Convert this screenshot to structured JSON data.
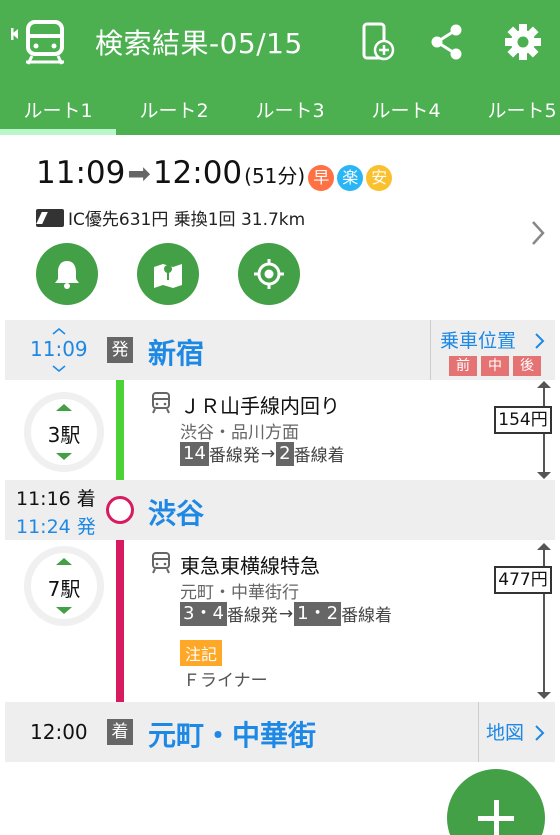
{
  "header": {
    "title": "検索結果-05/15",
    "icons": [
      "back-train-icon",
      "add-to-device-icon",
      "share-icon",
      "settings-gear-icon"
    ],
    "tabs": [
      {
        "label": "ルート1",
        "selected": true
      },
      {
        "label": "ルート2"
      },
      {
        "label": "ルート3"
      },
      {
        "label": "ルート4"
      },
      {
        "label": "ルート5"
      }
    ],
    "color": "#4caf50"
  },
  "summary": {
    "depart": "11:09",
    "arrive": "12:00",
    "duration": "(51分)",
    "badges": [
      "早",
      "楽",
      "安"
    ],
    "fare_info": "IC優先631円 乗換1回 31.7km",
    "actions": [
      "alarm-bell-icon",
      "map-icon",
      "location-target-icon"
    ]
  },
  "route": {
    "origin": {
      "time": "11:09",
      "mark": "発",
      "name": "新宿",
      "car_position_label": "乗車位置",
      "car_tags": [
        "前",
        "中",
        "後"
      ]
    },
    "leg1": {
      "stops": "3駅",
      "line": "ＪＲ山手線内回り",
      "direction": "渋谷・品川方面",
      "dep_platform": "14",
      "dep_suffix": "番線発",
      "arr_platform": "2",
      "arr_suffix": "番線着",
      "arrow": "→",
      "fare": "154円",
      "color": "#4cd137"
    },
    "transfer": {
      "arr_time": "11:16 着",
      "dep_time": "11:24 発",
      "name": "渋谷"
    },
    "leg2": {
      "stops": "7駅",
      "line": "東急東横線特急",
      "direction": "元町・中華街行",
      "dep_platform": "3・4",
      "dep_suffix": "番線発",
      "arr_platform": "1・2",
      "arr_suffix": "番線着",
      "arrow": "→",
      "note_badge": "注記",
      "note": "Ｆライナー",
      "fare": "477円",
      "color": "#d81b60"
    },
    "destination": {
      "time": "12:00",
      "mark": "着",
      "name": "元町・中華街",
      "map_label": "地図"
    }
  },
  "fab": {
    "icon": "plus-icon"
  }
}
